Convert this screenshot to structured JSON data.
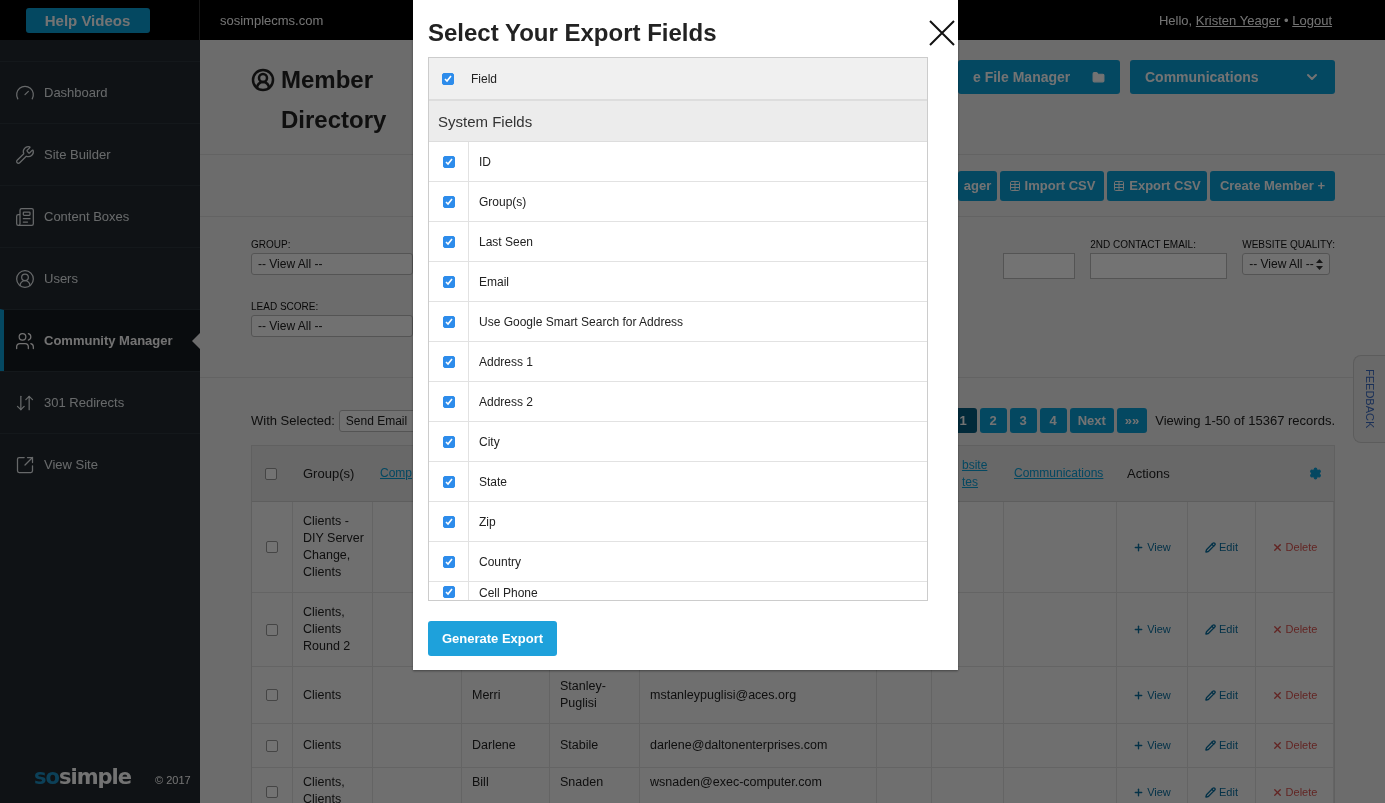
{
  "topbar": {
    "help_button": "Help Videos",
    "site": "sosimplecms.com",
    "greeting": "Hello,",
    "user": "Kristen Yeager",
    "separator": "•",
    "logout": "Logout"
  },
  "sidebar": {
    "items": [
      {
        "label": "Dashboard",
        "selected": false
      },
      {
        "label": "Site Builder",
        "selected": false
      },
      {
        "label": "Content Boxes",
        "selected": false
      },
      {
        "label": "Users",
        "selected": false
      },
      {
        "label": "Community Manager",
        "selected": true
      },
      {
        "label": "301 Redirects",
        "selected": false
      },
      {
        "label": "View Site",
        "selected": false
      }
    ],
    "footer": {
      "logo_accent": "so",
      "logo_rest": "simple",
      "copyright": "© 2017"
    }
  },
  "page": {
    "title": "Member Directory",
    "header_buttons": [
      {
        "label": "e File Manager",
        "kind": "folder"
      },
      {
        "label": "Communications",
        "kind": "dropdown"
      }
    ],
    "toolbar_buttons": [
      {
        "label": "ager",
        "kind": "plain"
      },
      {
        "label": "Import CSV",
        "kind": "table"
      },
      {
        "label": "Export CSV",
        "kind": "table"
      },
      {
        "label": "Create Member +",
        "kind": "plain"
      }
    ],
    "filters_left": [
      {
        "label": "GROUP:",
        "value": "-- View All --"
      },
      {
        "label": "LEAD SCORE:",
        "value": "-- View All --"
      }
    ],
    "filters_right": [
      {
        "kind": "input"
      },
      {
        "kind": "input",
        "label": "2ND CONTACT EMAIL:"
      },
      {
        "kind": "select",
        "label": "WEBSITE QUALITY:",
        "value": "-- View All --"
      }
    ],
    "bulk": {
      "label": "With Selected:",
      "value": "Send Email"
    },
    "pages": [
      {
        "label": "1",
        "selected": true
      },
      {
        "label": "2",
        "selected": false
      },
      {
        "label": "3",
        "selected": false
      },
      {
        "label": "4",
        "selected": false
      }
    ],
    "nav_buttons": [
      "Next",
      "»»"
    ],
    "records": "Viewing 1-50 of 15367 records.",
    "feedback": "FEEDBACK"
  },
  "table": {
    "header_checked": false,
    "columns": [
      {
        "label": "Group(s)",
        "kind": "text"
      },
      {
        "label": "Comp",
        "kind": "link"
      },
      {
        "label": "bsite tes",
        "kind": "link"
      },
      {
        "label": "Communications",
        "kind": "link"
      },
      {
        "label": "Actions",
        "kind": "text"
      }
    ],
    "rows": [
      {
        "checked": false,
        "group": "Clients - DIY Server Change, Clients",
        "actions": [
          {
            "kind": "view",
            "label": "View"
          },
          {
            "kind": "edit",
            "label": "Edit"
          },
          {
            "kind": "delete",
            "label": "Delete"
          }
        ]
      },
      {
        "checked": false,
        "group": "Clients, Clients Round 2",
        "actions": [
          {
            "kind": "view",
            "label": "View"
          },
          {
            "kind": "edit",
            "label": "Edit"
          },
          {
            "kind": "delete",
            "label": "Delete"
          }
        ]
      },
      {
        "checked": false,
        "group": "Clients",
        "first": "Merri",
        "last": "Stanley-Puglisi",
        "email": "mstanleypuglisi@aces.org",
        "actions": [
          {
            "kind": "view",
            "label": "View"
          },
          {
            "kind": "edit",
            "label": "Edit"
          },
          {
            "kind": "delete",
            "label": "Delete"
          }
        ]
      },
      {
        "checked": false,
        "group": "Clients",
        "first": "Darlene",
        "last": "Stabile",
        "email": "darlene@daltonenterprises.com",
        "actions": [
          {
            "kind": "view",
            "label": "View"
          },
          {
            "kind": "edit",
            "label": "Edit"
          },
          {
            "kind": "delete",
            "label": "Delete"
          }
        ]
      },
      {
        "checked": false,
        "group": "Clients, Clients",
        "first": "Bill",
        "last": "Snaden",
        "email": "wsnaden@exec-computer.com",
        "actions": [
          {
            "kind": "view",
            "label": "View"
          },
          {
            "kind": "edit",
            "label": "Edit"
          },
          {
            "kind": "delete",
            "label": "Delete"
          }
        ]
      }
    ]
  },
  "modal": {
    "title": "Select Your Export Fields",
    "header": {
      "label": "Field",
      "checked": true
    },
    "section": "System Fields",
    "fields": [
      {
        "label": "ID",
        "checked": true
      },
      {
        "label": "Group(s)",
        "checked": true
      },
      {
        "label": "Last Seen",
        "checked": true
      },
      {
        "label": "Email",
        "checked": true
      },
      {
        "label": "Use Google Smart Search for Address",
        "checked": true
      },
      {
        "label": "Address 1",
        "checked": true
      },
      {
        "label": "Address 2",
        "checked": true
      },
      {
        "label": "City",
        "checked": true
      },
      {
        "label": "State",
        "checked": true
      },
      {
        "label": "Zip",
        "checked": true
      },
      {
        "label": "Country",
        "checked": true
      },
      {
        "label": "Cell Phone",
        "checked": true
      }
    ],
    "button": "Generate Export"
  }
}
